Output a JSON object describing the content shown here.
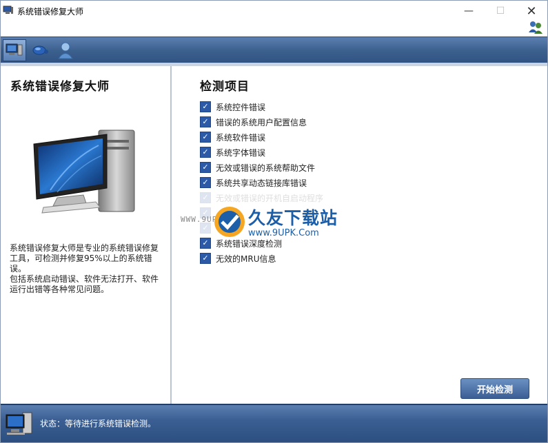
{
  "window": {
    "title": "系统错误修复大师",
    "minimize": "—",
    "maximize": "☐",
    "close": "✕"
  },
  "toolbar": {
    "items": [
      {
        "name": "computer-icon",
        "active": true
      },
      {
        "name": "mouse-icon",
        "active": false
      },
      {
        "name": "user-icon",
        "active": false
      }
    ]
  },
  "left_panel": {
    "title": "系统错误修复大师",
    "description_1": "系统错误修复大师是专业的系统错误修复工具，可检测并修复95%以上的系统错误。",
    "description_2": "包括系统启动错误、软件无法打开、软件运行出错等各种常见问题。"
  },
  "right_panel": {
    "title": "检测项目",
    "items": [
      {
        "label": "系统控件错误",
        "checked": true
      },
      {
        "label": "错误的系统用户配置信息",
        "checked": true
      },
      {
        "label": "系统软件错误",
        "checked": true
      },
      {
        "label": "系统字体错误",
        "checked": true
      },
      {
        "label": "无效或错误的系统帮助文件",
        "checked": true
      },
      {
        "label": "系统共享动态链接库错误",
        "checked": true
      },
      {
        "label": "无效或错误的开机自启动程序",
        "checked": true
      },
      {
        "label": "",
        "checked": true
      },
      {
        "label": "",
        "checked": true
      },
      {
        "label": "系统错误深度检测",
        "checked": true
      },
      {
        "label": "无效的MRU信息",
        "checked": true
      }
    ],
    "start_button": "开始检测"
  },
  "watermark": {
    "brand": "久友下载站",
    "url": "www.9UPK.Com",
    "left_text": "WWW.9UPK.COM"
  },
  "status": {
    "text": "状态：等待进行系统错误检测。"
  },
  "colors": {
    "toolbar": "#3d618f",
    "checkbox": "#2c5aa6",
    "button": "#4d73a8"
  }
}
